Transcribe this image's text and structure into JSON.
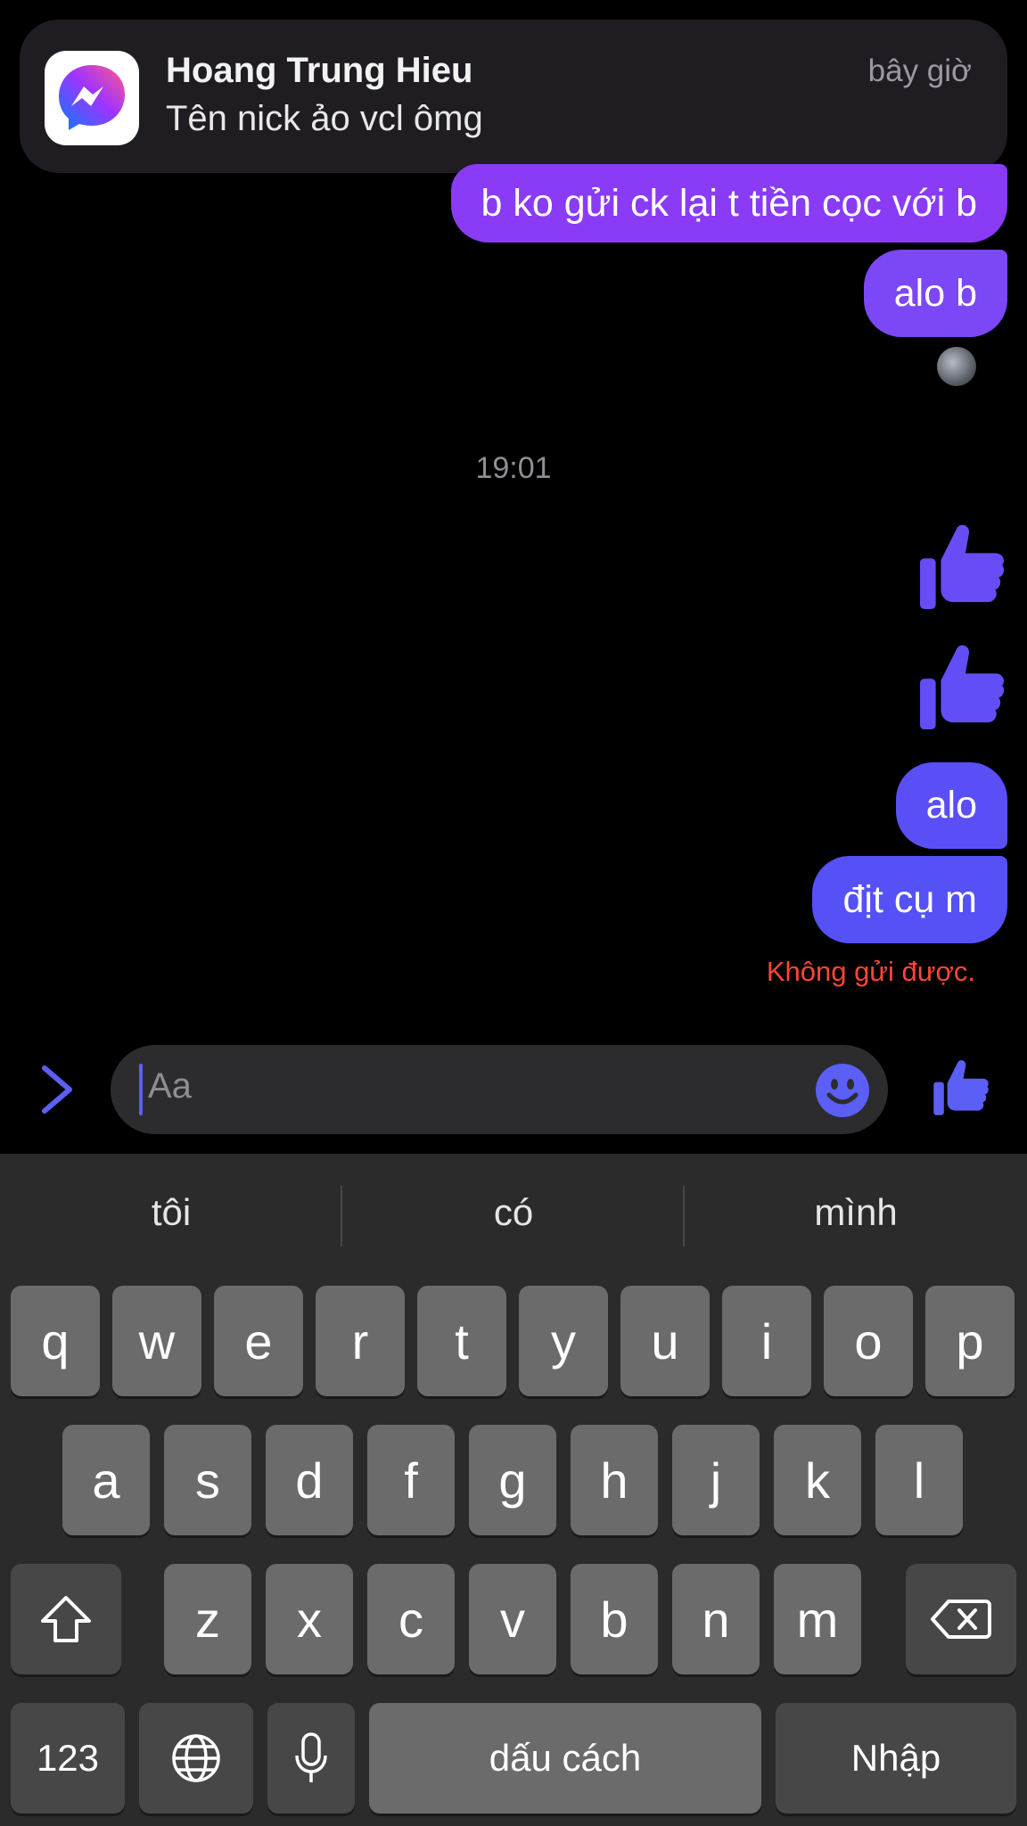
{
  "notification": {
    "app_icon": "messenger-icon",
    "sender": "Hoang Trung Hieu",
    "time": "bây giờ",
    "message": "Tên nick ảo vcl ômg"
  },
  "chat": {
    "messages": [
      {
        "text": "b ko gửi ck lại t tiền cọc với b"
      },
      {
        "text": "alo b"
      }
    ],
    "timestamp": "19:01",
    "later_messages": [
      {
        "text": "alo"
      },
      {
        "text": "địt cụ m"
      }
    ],
    "error": "Không gửi được.",
    "colors": {
      "bubble_purple": "#8a3bf6",
      "bubble_blue": "#5a4ff7",
      "error": "#ff453a"
    }
  },
  "composer": {
    "placeholder": "Aa"
  },
  "keyboard": {
    "suggestions": [
      "tôi",
      "có",
      "mình"
    ],
    "row1": [
      "q",
      "w",
      "e",
      "r",
      "t",
      "y",
      "u",
      "i",
      "o",
      "p"
    ],
    "row2": [
      "a",
      "s",
      "d",
      "f",
      "g",
      "h",
      "j",
      "k",
      "l"
    ],
    "row3": [
      "z",
      "x",
      "c",
      "v",
      "b",
      "n",
      "m"
    ],
    "numbers_label": "123",
    "space_label": "dấu cách",
    "return_label": "Nhập"
  }
}
